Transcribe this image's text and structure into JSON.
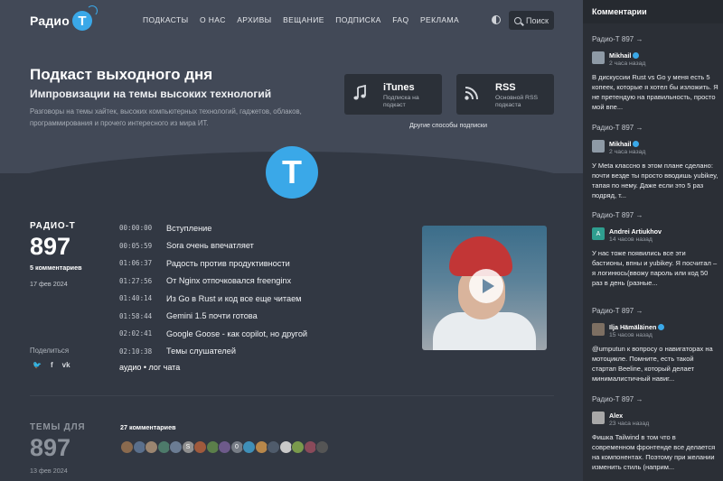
{
  "header": {
    "logo_text": "Радио",
    "logo_letter": "Т",
    "nav": [
      "ПОДКАСТЫ",
      "О НАС",
      "АРХИВЫ",
      "ВЕЩАНИЕ",
      "ПОДПИСКА",
      "FAQ",
      "РЕКЛАМА"
    ],
    "search_label": "Поиск"
  },
  "hero": {
    "title": "Подкаст выходного дня",
    "subtitle": "Импровизации на темы высоких технологий",
    "description": "Разговоры на темы хайтек, высоких компьютерных технологий, гаджетов, облаков, программирования и прочего интересного из мира ИТ.",
    "itunes": {
      "title": "iTunes",
      "sub": "Подписка на подкаст",
      "icon": "music-note-icon"
    },
    "rss": {
      "title": "RSS",
      "sub": "Основной RSS подкаста",
      "icon": "rss-icon"
    },
    "other_subs": "Другие способы подписки",
    "big_logo_letter": "Т"
  },
  "episode": {
    "label": "РАДИО-Т",
    "number": "897",
    "comments": "5 комментариев",
    "date": "17 фев 2024",
    "share_label": "Поделиться",
    "share_icons": [
      "twitter-icon",
      "facebook-icon",
      "vk-icon"
    ],
    "share_glyphs": [
      "🐦",
      "f",
      "vk"
    ],
    "timeline": [
      {
        "time": "00:00:00",
        "text": "Вступление"
      },
      {
        "time": "00:05:59",
        "text": "Sora очень впечатляет"
      },
      {
        "time": "01:06:37",
        "text": "Радость против продуктивности"
      },
      {
        "time": "01:27:56",
        "text": "От Nginx отпочковался freenginx"
      },
      {
        "time": "01:40:14",
        "text": "Из Go в Rust и код все еще читаем"
      },
      {
        "time": "01:58:44",
        "text": "Gemini 1.5 почти готова"
      },
      {
        "time": "02:02:41",
        "text": "Google Goose - как copilot, но другой"
      },
      {
        "time": "02:10:38",
        "text": "Темы слушателей"
      }
    ],
    "media_links": "аудио • лог чата"
  },
  "next": {
    "label": "ТЕМЫ ДЛЯ",
    "number": "897",
    "date": "13 фев 2024",
    "comments": "27 комментариев",
    "avatars": [
      {
        "color": "#8a6a4e",
        "letter": ""
      },
      {
        "color": "#5a6f8c",
        "letter": ""
      },
      {
        "color": "#9b8570",
        "letter": ""
      },
      {
        "color": "#4d7a6a",
        "letter": ""
      },
      {
        "color": "#6b7c93",
        "letter": ""
      },
      {
        "color": "#8f8f8f",
        "letter": "S"
      },
      {
        "color": "#a05a3c",
        "letter": ""
      },
      {
        "color": "#5b7f4a",
        "letter": ""
      },
      {
        "color": "#6d5a8a",
        "letter": ""
      },
      {
        "color": "#777d86",
        "letter": "0"
      },
      {
        "color": "#3f8fb8",
        "letter": ""
      },
      {
        "color": "#b8874a",
        "letter": ""
      },
      {
        "color": "#4f5b6b",
        "letter": ""
      },
      {
        "color": "#c9c9c9",
        "letter": ""
      },
      {
        "color": "#7a9a4c",
        "letter": ""
      },
      {
        "color": "#8a4a5a",
        "letter": ""
      },
      {
        "color": "#555555",
        "letter": ""
      }
    ]
  },
  "sidebar": {
    "title": "Комментарии",
    "items": [
      {
        "episode": "Радио-Т 897 →",
        "name": "Mikhail",
        "verified": true,
        "time": "2 часа назад",
        "text": "В дискуссии Rust vs Go у меня есть 5 копеек, которые я хотел бы изложить. Я не претендую на правильность, просто мой впе...",
        "ava": "#8e9aa6"
      },
      {
        "episode": "Радио-Т 897 →",
        "name": "Mikhail",
        "verified": true,
        "time": "2 часа назад",
        "text": "У Meta классно в этом плане сделано: почти везде ты просто вводишь yubikey, тапая по нему. Даже если это 5 раз подряд, т...",
        "ava": "#8e9aa6"
      },
      {
        "episode": "Радио-Т 897 →",
        "name": "Andrei Artiukhov",
        "verified": false,
        "time": "14 часов назад",
        "text": "У нас тоже появились все эти бастионы, впны и yubikey. Я посчитал – я логинюсь(ввожу пароль или код 50 раз в день (разные...",
        "ava": "#2f9e8f",
        "ava_letter": "A"
      },
      {
        "episode": "Радио-Т 897 →",
        "name": "Ilja Hämäläinen",
        "verified": true,
        "time": "15 часов назад",
        "text": "@umputun к вопросу о навигаторах на мотоцикле. Помните, есть такой стартап Beeline, который делает минималистичный навиг...",
        "ava": "#7d6f62"
      },
      {
        "episode": "Радио-Т 897 →",
        "name": "Alex",
        "verified": false,
        "time": "23 часа назад",
        "text": "Фишка Tailwind в том что в современном фронтенде все делается на компонентах. Поэтому при желании изменить стиль (наприм...",
        "ava": "#a8a8a8"
      }
    ]
  }
}
